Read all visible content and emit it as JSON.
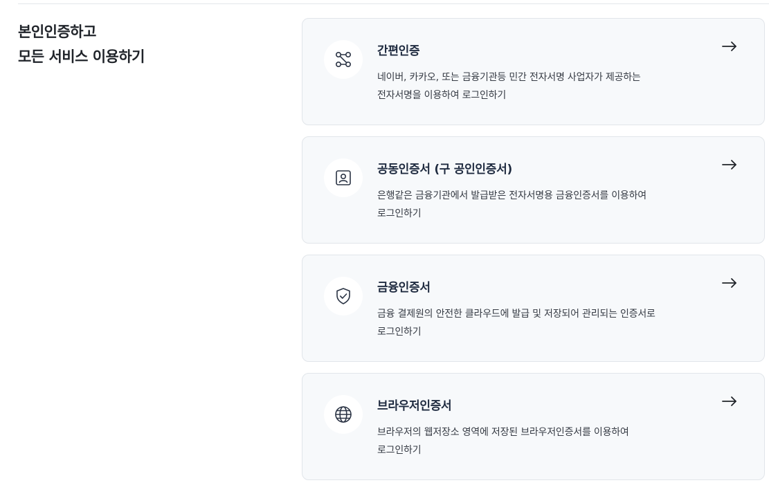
{
  "section": {
    "heading_line1": "본인인증하고",
    "heading_line2": "모든 서비스 이용하기"
  },
  "cards": [
    {
      "icon": "simple-auth-icon",
      "title": "간편인증",
      "desc_line1": "네이버, 카카오, 또는 금융기관등 민간 전자서명 사업자가 제공하는",
      "desc_line2": "전자서명을 이용하여 로그인하기"
    },
    {
      "icon": "id-card-icon",
      "title": "공동인증서 (구 공인인증서)",
      "desc_line1": "은행같은 금융기관에서 발급받은 전자서명용 금융인증서를 이용하여",
      "desc_line2": "로그인하기"
    },
    {
      "icon": "shield-check-icon",
      "title": "금융인증서",
      "desc_line1": "금융 결제원의 안전한 클라우드에 발급 및 저장되어 관리되는 인증서로",
      "desc_line2": "로그인하기"
    },
    {
      "icon": "globe-icon",
      "title": "브라우저인증서",
      "desc_line1": "브라우저의 웹저장소 영역에 저장된 브라우저인증서를 이용하여",
      "desc_line2": "로그인하기"
    }
  ],
  "colors": {
    "card_bg": "#f7f9fb",
    "card_border": "#e1e5ea",
    "title": "#1e2a3f",
    "icon_stroke": "#2a3344"
  }
}
